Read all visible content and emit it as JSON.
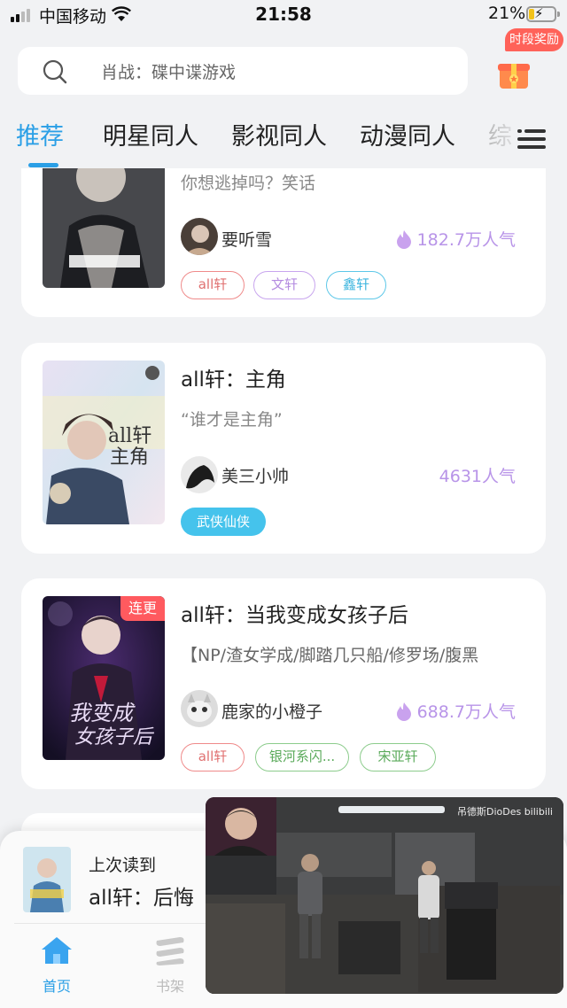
{
  "status_bar": {
    "carrier": "中国移动",
    "time": "21:58",
    "battery_percent": "21%",
    "battery_level": 0.21,
    "wifi_icon": "wifi-icon",
    "signal_icon": "signal-icon"
  },
  "search": {
    "placeholder": "肖战：碟中谍游戏",
    "icon": "search-icon"
  },
  "reward": {
    "label": "时段奖励",
    "icon": "gift-icon"
  },
  "tabs": {
    "items": [
      "推荐",
      "明星同人",
      "影视同人",
      "动漫同人",
      "综"
    ],
    "active_index": 0,
    "menu_icon": "menu-icon"
  },
  "cards": [
    {
      "title": "",
      "desc": "你想逃掉吗？笑话",
      "author": "要听雪",
      "popularity": "182.7万人气",
      "has_flame": true,
      "tags": [
        "all轩",
        "文轩",
        "鑫轩"
      ],
      "update_badge": ""
    },
    {
      "title": "all轩：主角",
      "desc": "“谁才是主角”",
      "author": "美三小帅",
      "popularity": "4631人气",
      "has_flame": false,
      "tags": [
        "武侠仙侠"
      ],
      "update_badge": ""
    },
    {
      "title": "all轩：当我变成女孩子后",
      "desc": "【NP/渣女学成/脚踏几只船/修罗场/腹黑",
      "author": "鹿家的小橙子",
      "popularity": "688.7万人气",
      "has_flame": true,
      "tags": [
        "all轩",
        "银河系闪...",
        "宋亚轩"
      ],
      "update_badge": "连更"
    }
  ],
  "last_read": {
    "label": "上次读到",
    "title": "all轩：后悔"
  },
  "nav": {
    "home": "首页",
    "shelf": "书架",
    "home_icon": "home-icon",
    "shelf_icon": "bookshelf-icon"
  },
  "video_overlay": {
    "watermark": "吊德斯DioDes bilibili"
  },
  "colors": {
    "accent": "#2a9fe6",
    "popularity": "#b894e8",
    "update_badge": "#ff5a5f",
    "background": "#f1f2f4"
  }
}
